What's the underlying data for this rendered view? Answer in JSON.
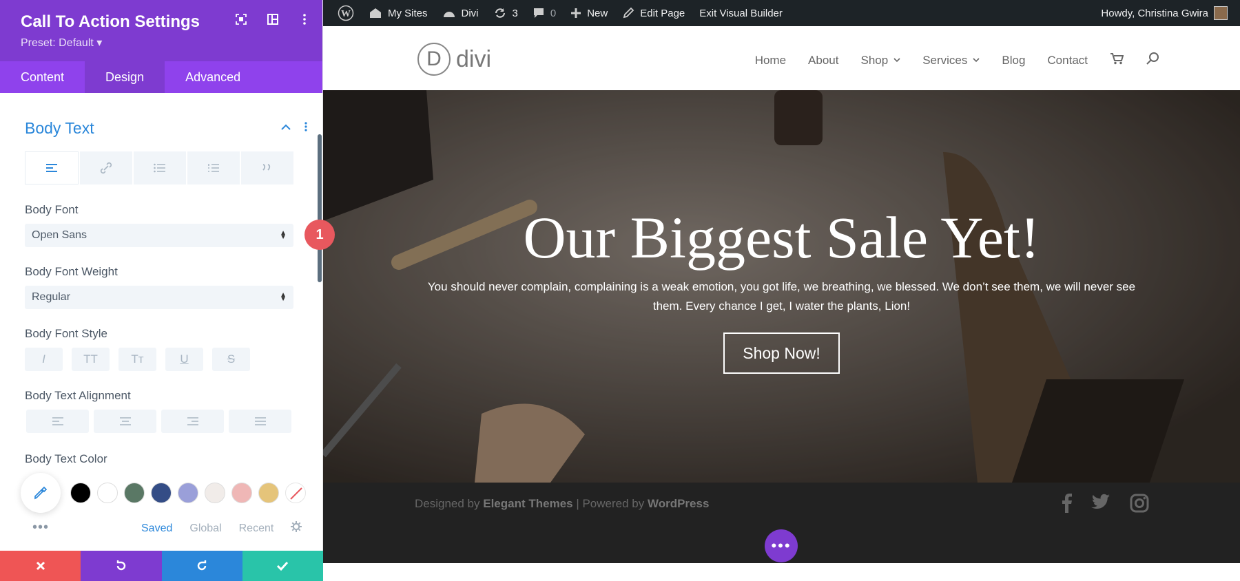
{
  "panel": {
    "title": "Call To Action Settings",
    "preset": "Preset: Default ▾",
    "tabs": [
      {
        "label": "Content"
      },
      {
        "label": "Design"
      },
      {
        "label": "Advanced"
      }
    ],
    "section_title": "Body Text",
    "body_font": {
      "label": "Body Font",
      "value": "Open Sans"
    },
    "body_font_weight": {
      "label": "Body Font Weight",
      "value": "Regular"
    },
    "body_font_style_label": "Body Font Style",
    "font_style_buttons": [
      "I",
      "TT",
      "Tт",
      "U",
      "S"
    ],
    "body_text_alignment_label": "Body Text Alignment",
    "body_text_color_label": "Body Text Color",
    "swatch_colors": [
      "#000000",
      "#ffffff",
      "#5a7865",
      "#344d86",
      "#9a9fd9",
      "#f1ece9",
      "#efb7b6",
      "#e5c47a"
    ],
    "color_tabs": {
      "saved": "Saved",
      "global": "Global",
      "recent": "Recent"
    },
    "footer_colors": {
      "cancel": "#ef5555",
      "undo": "#7e3bd0",
      "redo": "#2b87da",
      "save": "#29c4a9"
    },
    "badge": "1"
  },
  "adminbar": {
    "my_sites": "My Sites",
    "divi": "Divi",
    "updates": "3",
    "comments": "0",
    "new": "New",
    "edit_page": "Edit Page",
    "exit_builder": "Exit Visual Builder",
    "howdy": "Howdy, Christina Gwira"
  },
  "site": {
    "logo": "divi",
    "nav": [
      {
        "label": "Home"
      },
      {
        "label": "About"
      },
      {
        "label": "Shop"
      },
      {
        "label": "Services"
      },
      {
        "label": "Blog"
      },
      {
        "label": "Contact"
      }
    ],
    "hero": {
      "heading": "Our Biggest Sale Yet!",
      "text": "You should never complain, complaining is a weak emotion, you got life, we breathing, we blessed. We don’t see them, we will never see them. Every chance I get, I water the plants, Lion!",
      "button": "Shop Now!"
    },
    "footer": {
      "designed_by": "Designed by ",
      "elegant": "Elegant Themes",
      "sep": " | Powered by ",
      "wordpress": "WordPress"
    }
  }
}
